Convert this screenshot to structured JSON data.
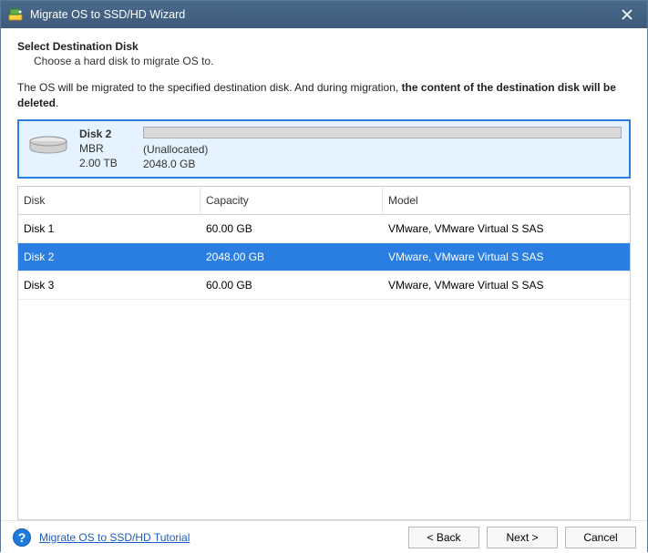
{
  "window": {
    "title": "Migrate OS to SSD/HD Wizard"
  },
  "header": {
    "heading": "Select Destination Disk",
    "subtext": "Choose a hard disk to migrate OS to."
  },
  "warning": {
    "prefix": "The OS will be migrated to the specified destination disk. And during migration, ",
    "bold": "the content of the destination disk will be deleted",
    "suffix": "."
  },
  "preview": {
    "disk_name": "Disk 2",
    "partition_style": "MBR",
    "size": "2.00 TB",
    "segment_label": "(Unallocated)",
    "segment_size": "2048.0 GB"
  },
  "table": {
    "columns": {
      "disk": "Disk",
      "capacity": "Capacity",
      "model": "Model"
    },
    "rows": [
      {
        "disk": "Disk 1",
        "capacity": "60.00 GB",
        "model": "VMware, VMware Virtual S SAS",
        "selected": false
      },
      {
        "disk": "Disk 2",
        "capacity": "2048.00 GB",
        "model": "VMware, VMware Virtual S SAS",
        "selected": true
      },
      {
        "disk": "Disk 3",
        "capacity": "60.00 GB",
        "model": "VMware, VMware Virtual S SAS",
        "selected": false
      }
    ]
  },
  "footer": {
    "tutorial_link": "Migrate OS to SSD/HD Tutorial",
    "back": "< Back",
    "next": "Next >",
    "cancel": "Cancel"
  }
}
